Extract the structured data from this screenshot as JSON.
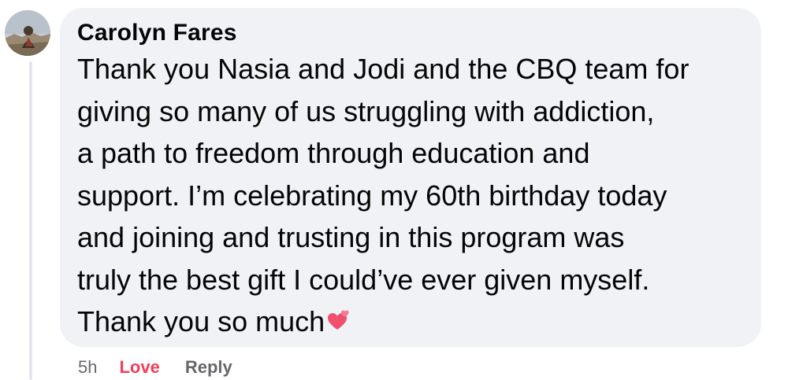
{
  "comment": {
    "author": "Carolyn Fares",
    "text_lines": [
      "Thank you Nasia and Jodi and the CBQ team for",
      "giving so many of us struggling with addiction,",
      "a path to freedom through education and",
      "support. I’m celebrating my 60th birthday today",
      "and joining and trusting in this program was",
      "truly the best gift I could’ve ever given myself.",
      "Thank you so much"
    ],
    "emoji_icon": "two-hearts-emoji",
    "emoji_color": "#f0506e"
  },
  "actions": {
    "timestamp": "5h",
    "reaction_label": "Love",
    "reaction_color": "#f33e58",
    "reply_label": "Reply"
  },
  "colors": {
    "bubble": "#f0f2f5",
    "text": "#050505",
    "secondary": "#65676b"
  }
}
